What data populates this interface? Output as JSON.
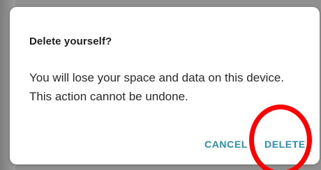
{
  "dialog": {
    "title": "Delete yourself?",
    "message": "You will lose your space and data on this device. This action cannot be undone.",
    "cancel_label": "CANCEL",
    "delete_label": "DELETE"
  },
  "colors": {
    "accent": "#2b8eae",
    "highlight": "#ff0000",
    "backdrop": "#8f8f8f"
  }
}
